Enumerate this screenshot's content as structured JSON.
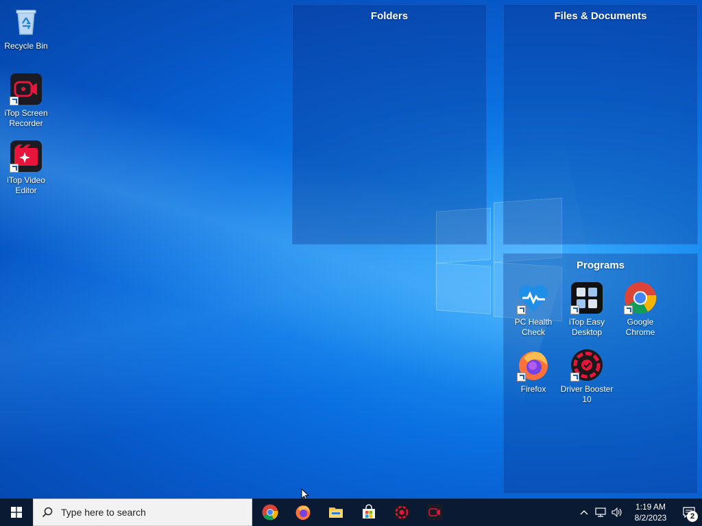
{
  "desktop": {
    "icons": [
      {
        "label": "Recycle Bin",
        "icon": "recycle-bin-icon"
      },
      {
        "label": "iTop Screen Recorder",
        "icon": "itop-screen-recorder-icon"
      },
      {
        "label": "iTop Video Editor",
        "icon": "itop-video-editor-icon"
      }
    ]
  },
  "fences": {
    "folders": {
      "title": "Folders"
    },
    "files": {
      "title": "Files & Documents"
    },
    "programs": {
      "title": "Programs",
      "items": [
        {
          "label": "PC Health Check",
          "icon": "pc-health-check-icon"
        },
        {
          "label": "iTop Easy Desktop",
          "icon": "itop-easy-desktop-icon"
        },
        {
          "label": "Google Chrome",
          "icon": "chrome-icon"
        },
        {
          "label": "Firefox",
          "icon": "firefox-icon"
        },
        {
          "label": "Driver Booster 10",
          "icon": "driver-booster-icon"
        }
      ]
    }
  },
  "taskbar": {
    "search_placeholder": "Type here to search",
    "apps": [
      "chrome-icon",
      "firefox-icon",
      "file-explorer-icon",
      "microsoft-store-icon",
      "driver-booster-icon",
      "itop-screen-recorder-icon"
    ],
    "clock": {
      "time": "1:19 AM",
      "date": "8/2/2023"
    },
    "notification_count": "2"
  },
  "colors": {
    "taskbar": "#0b1a33",
    "fence_bg": "rgba(10,45,130,0.32)",
    "itop_red": "#e8143c"
  }
}
